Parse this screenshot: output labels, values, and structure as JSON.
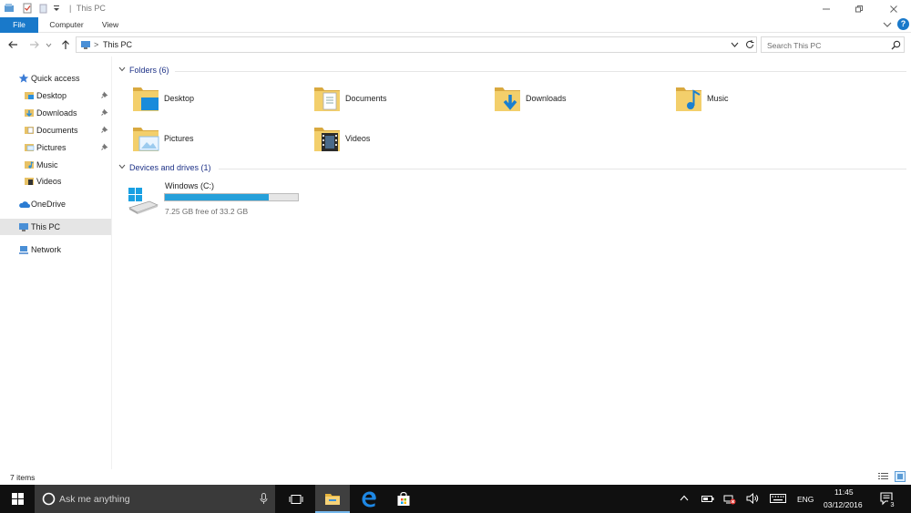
{
  "window": {
    "title_separator": "|",
    "title": "This PC"
  },
  "ribbon": {
    "tabs": [
      {
        "label": "File"
      },
      {
        "label": "Computer"
      },
      {
        "label": "View"
      }
    ],
    "help_label": "?"
  },
  "address": {
    "separator": ">",
    "location": "This PC",
    "search_placeholder": "Search This PC"
  },
  "nav": {
    "quick_access": {
      "label": "Quick access"
    },
    "quick_items": [
      {
        "label": "Desktop",
        "pinned": true
      },
      {
        "label": "Downloads",
        "pinned": true
      },
      {
        "label": "Documents",
        "pinned": true
      },
      {
        "label": "Pictures",
        "pinned": true
      },
      {
        "label": "Music",
        "pinned": false
      },
      {
        "label": "Videos",
        "pinned": false
      }
    ],
    "onedrive": {
      "label": "OneDrive"
    },
    "this_pc": {
      "label": "This PC"
    },
    "network": {
      "label": "Network"
    }
  },
  "content": {
    "folders_header": "Folders (6)",
    "folders": [
      {
        "label": "Desktop",
        "icon": "desktop-folder-icon"
      },
      {
        "label": "Documents",
        "icon": "documents-folder-icon"
      },
      {
        "label": "Downloads",
        "icon": "downloads-folder-icon"
      },
      {
        "label": "Music",
        "icon": "music-folder-icon"
      },
      {
        "label": "Pictures",
        "icon": "pictures-folder-icon"
      },
      {
        "label": "Videos",
        "icon": "videos-folder-icon"
      }
    ],
    "devices_header": "Devices and drives (1)",
    "drive": {
      "name": "Windows (C:)",
      "free_text": "7.25 GB free of 33.2 GB",
      "free_gb": 7.25,
      "total_gb": 33.2,
      "bar_color": "#26a0da"
    }
  },
  "status": {
    "item_count": "7 items"
  },
  "taskbar": {
    "search_placeholder": "Ask me anything",
    "language": "ENG",
    "time": "11:45",
    "date": "03/12/2016",
    "notification_count": "3"
  },
  "colors": {
    "accent": "#1979ca",
    "folder": "#e8c266",
    "selection": "#e5e5e5"
  }
}
